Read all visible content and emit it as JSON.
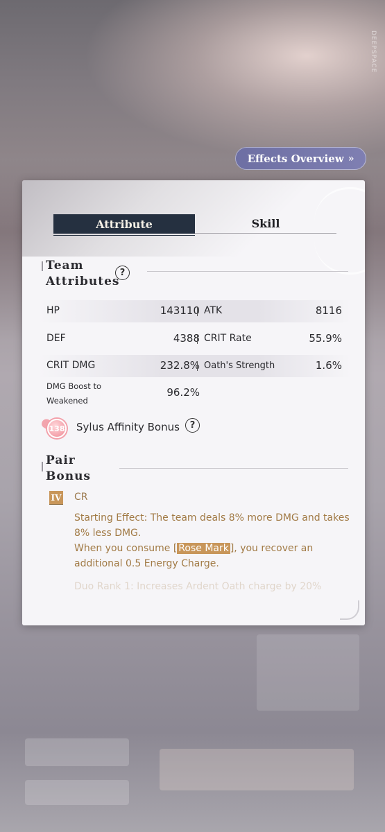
{
  "background": {
    "brand": "DEEPSPACE"
  },
  "effects_button": {
    "label": "Effects Overview",
    "icon": "double-chevron-right-icon"
  },
  "tabs": [
    {
      "label": "Attribute",
      "active": true
    },
    {
      "label": "Skill",
      "active": false
    }
  ],
  "team_attributes": {
    "title_line1": "Team",
    "title_line2": "Attributes",
    "rows": [
      {
        "left_label": "HP",
        "left_value": "143110",
        "right_label": "ATK",
        "right_value": "8116"
      },
      {
        "left_label": "DEF",
        "left_value": "4388",
        "right_label": "CRIT Rate",
        "right_value": "55.9%"
      },
      {
        "left_label": "CRIT DMG",
        "left_value": "232.8%",
        "right_label": "Oath's Strength",
        "right_value": "1.6%"
      }
    ],
    "extra": {
      "label_line1": "DMG Boost to",
      "label_line2": "Weakened",
      "value": "96.2%"
    }
  },
  "affinity": {
    "level": "138",
    "label": "Sylus Affinity Bonus"
  },
  "pair_bonus": {
    "title_line1": "Pair",
    "title_line2": "Bonus",
    "rank": "IV",
    "name": "CR",
    "effect_line1": "Starting Effect: The team deals 8% more DMG and takes 8% less DMG.",
    "effect_pre": "When you consume [",
    "effect_highlight": "Rose Mark",
    "effect_post": "], you recover an additional 0.5 Energy Charge.",
    "faded": "Duo Rank 1: Increases Ardent Oath charge by 20%"
  },
  "colors": {
    "accent_gold": "#a17a45",
    "tab_dark": "#253040",
    "button": "#7576aa"
  }
}
